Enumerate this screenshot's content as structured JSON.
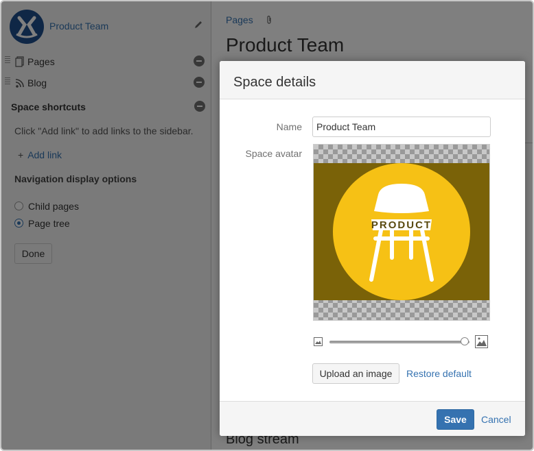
{
  "sidebar": {
    "space_name": "Product Team",
    "items": [
      {
        "label": "Pages",
        "icon": "pages-icon"
      },
      {
        "label": "Blog",
        "icon": "rss-icon"
      }
    ],
    "shortcuts_title": "Space shortcuts",
    "shortcuts_help": "Click \"Add link\" to add links to the sidebar.",
    "add_link_label": "Add link",
    "nav_options_title": "Navigation display options",
    "nav_options": [
      {
        "label": "Child pages",
        "checked": false
      },
      {
        "label": "Page tree",
        "checked": true
      }
    ],
    "done_label": "Done"
  },
  "main": {
    "breadcrumb": "Pages",
    "title": "Product Team",
    "blog_stream": "Blog stream"
  },
  "dialog": {
    "title": "Space details",
    "name_label": "Name",
    "name_value": "Product Team",
    "avatar_label": "Space avatar",
    "avatar_text": "PRODUCT",
    "zoom_level": 1.0,
    "upload_label": "Upload an image",
    "restore_label": "Restore default",
    "save_label": "Save",
    "cancel_label": "Cancel"
  },
  "colors": {
    "accent": "#3572b0",
    "avatar_yellow": "#f6c115",
    "avatar_band": "#7a6208"
  }
}
